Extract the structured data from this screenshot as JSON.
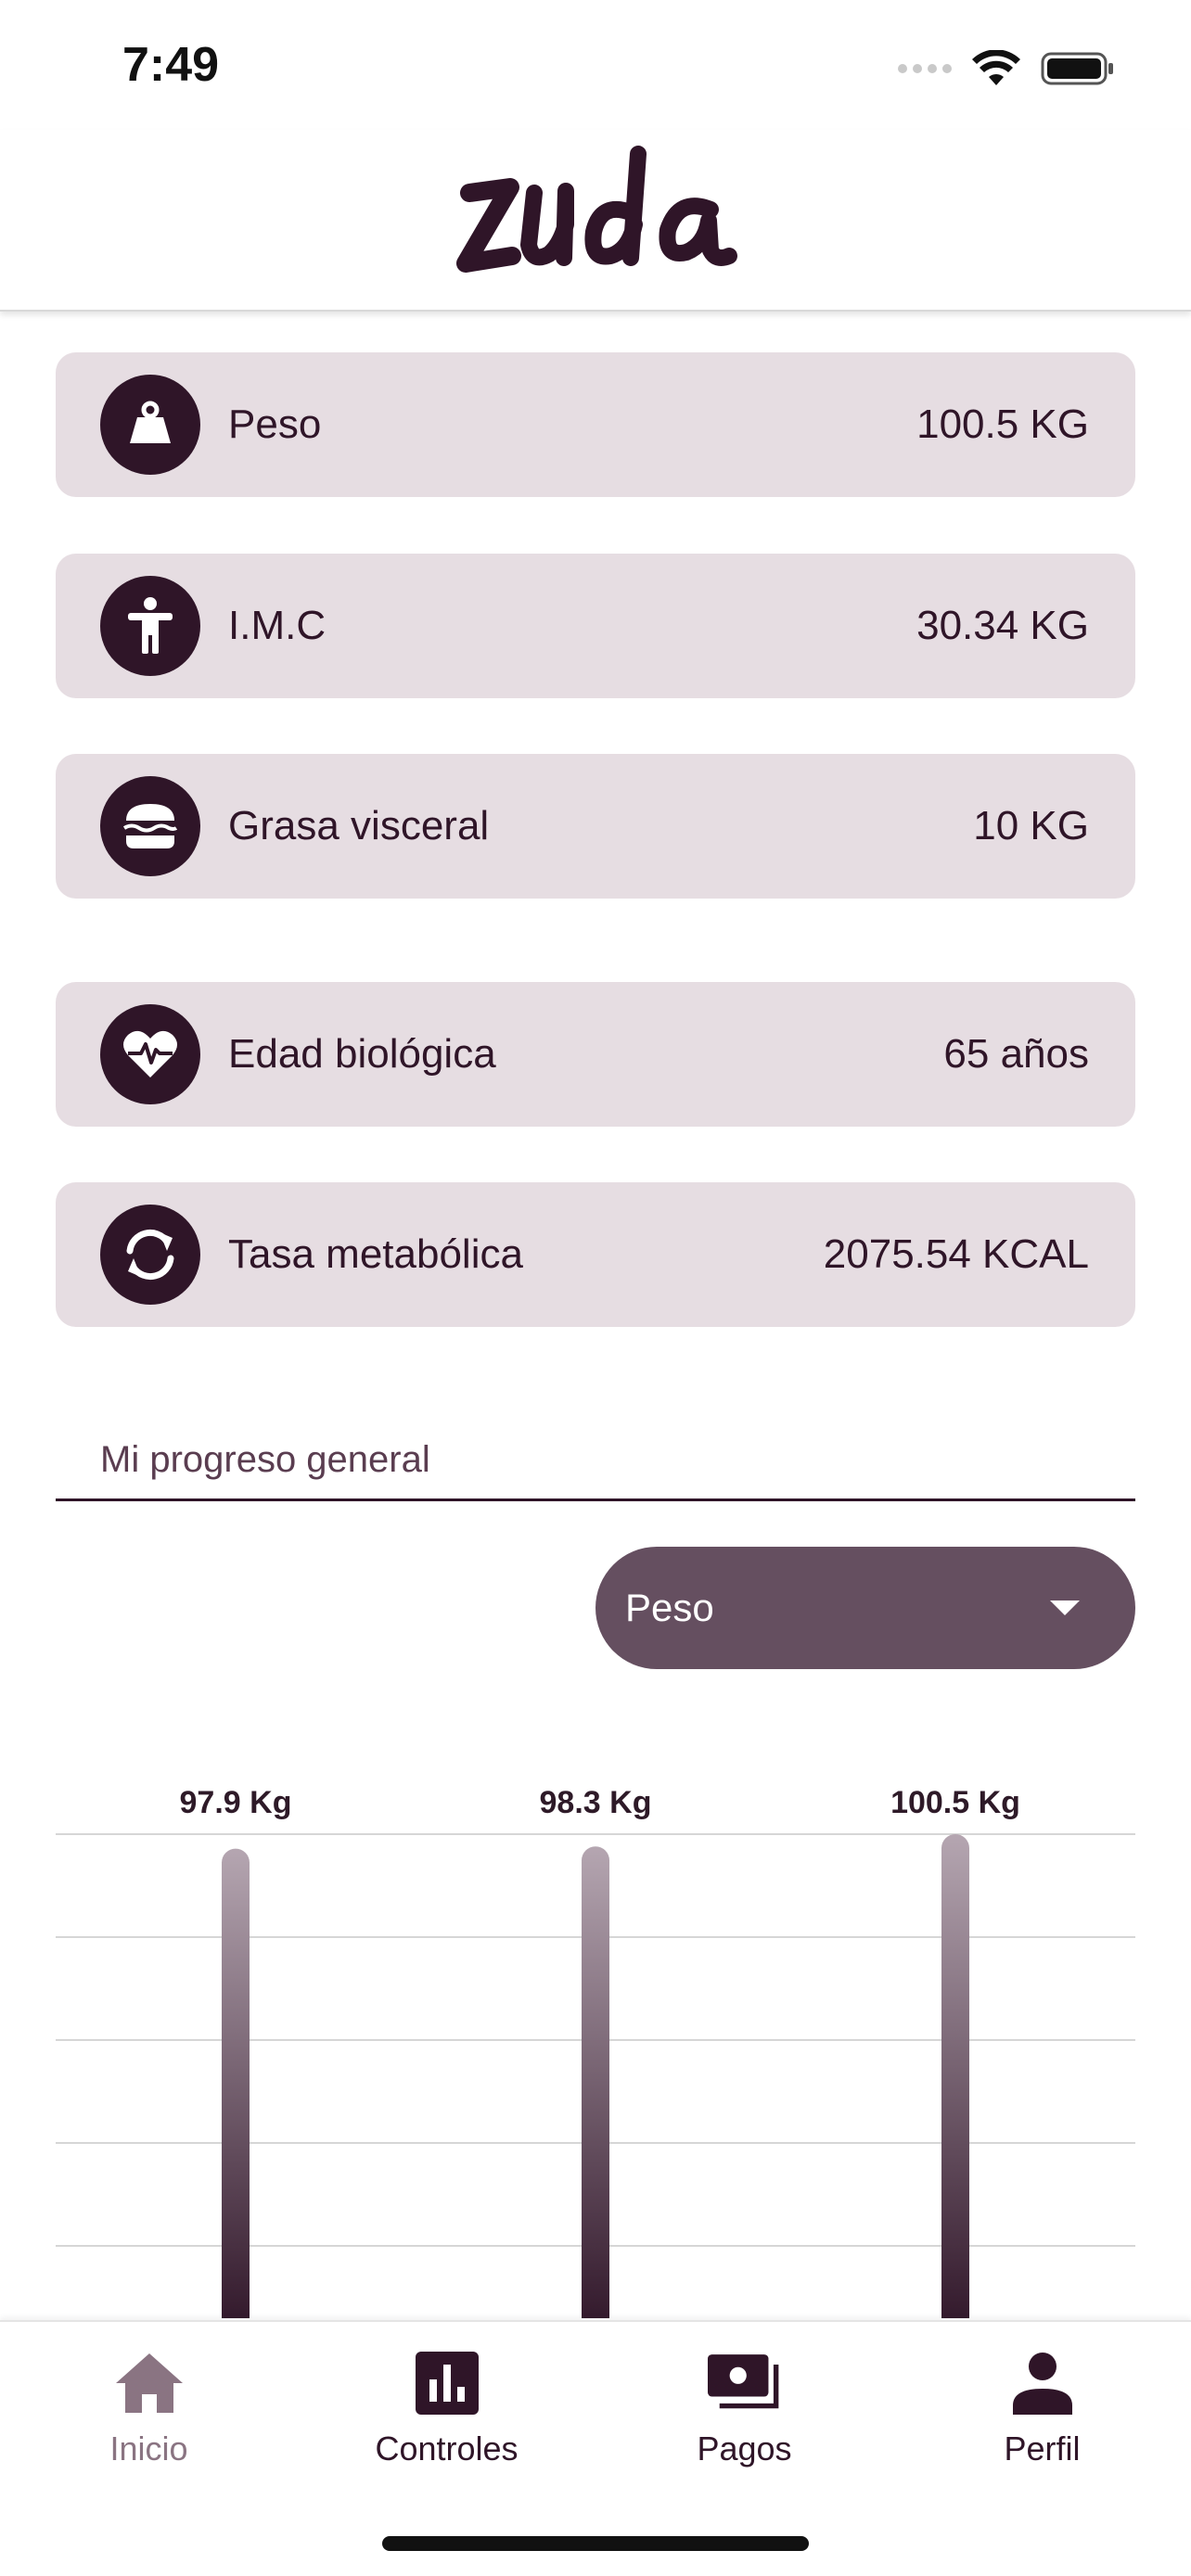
{
  "status_bar": {
    "time": "7:49"
  },
  "brand": {
    "logo_text": "zuda",
    "color": "#2f1528"
  },
  "metrics": [
    {
      "label": "Peso",
      "value": "100.5 KG",
      "icon": "weight-icon"
    },
    {
      "label": "I.M.C",
      "value": "30.34 KG",
      "icon": "body-icon"
    },
    {
      "label": "Grasa visceral",
      "value": "10 KG",
      "icon": "burger-icon"
    },
    {
      "label": "Edad biológica",
      "value": "65 años",
      "icon": "heart-pulse-icon"
    },
    {
      "label": "Tasa metabólica",
      "value": "2075.54 KCAL",
      "icon": "sync-icon"
    }
  ],
  "progress": {
    "title": "Mi progreso general",
    "selected_metric": "Peso"
  },
  "chart_data": {
    "type": "bar",
    "values": [
      97.9,
      98.3,
      100.5
    ],
    "data_labels": [
      "97.9 Kg",
      "98.3 Kg",
      "100.5 Kg"
    ],
    "grid": true
  },
  "nav": {
    "items": [
      {
        "label": "Inicio",
        "icon": "home-icon",
        "active": true
      },
      {
        "label": "Controles",
        "icon": "bar-chart-icon",
        "active": false
      },
      {
        "label": "Pagos",
        "icon": "payments-icon",
        "active": false
      },
      {
        "label": "Perfil",
        "icon": "person-icon",
        "active": false
      }
    ]
  },
  "colors": {
    "card_bg": "#e6dde2",
    "primary": "#2f1528",
    "select_bg": "#654f60",
    "nav_active": "#8a7482"
  }
}
